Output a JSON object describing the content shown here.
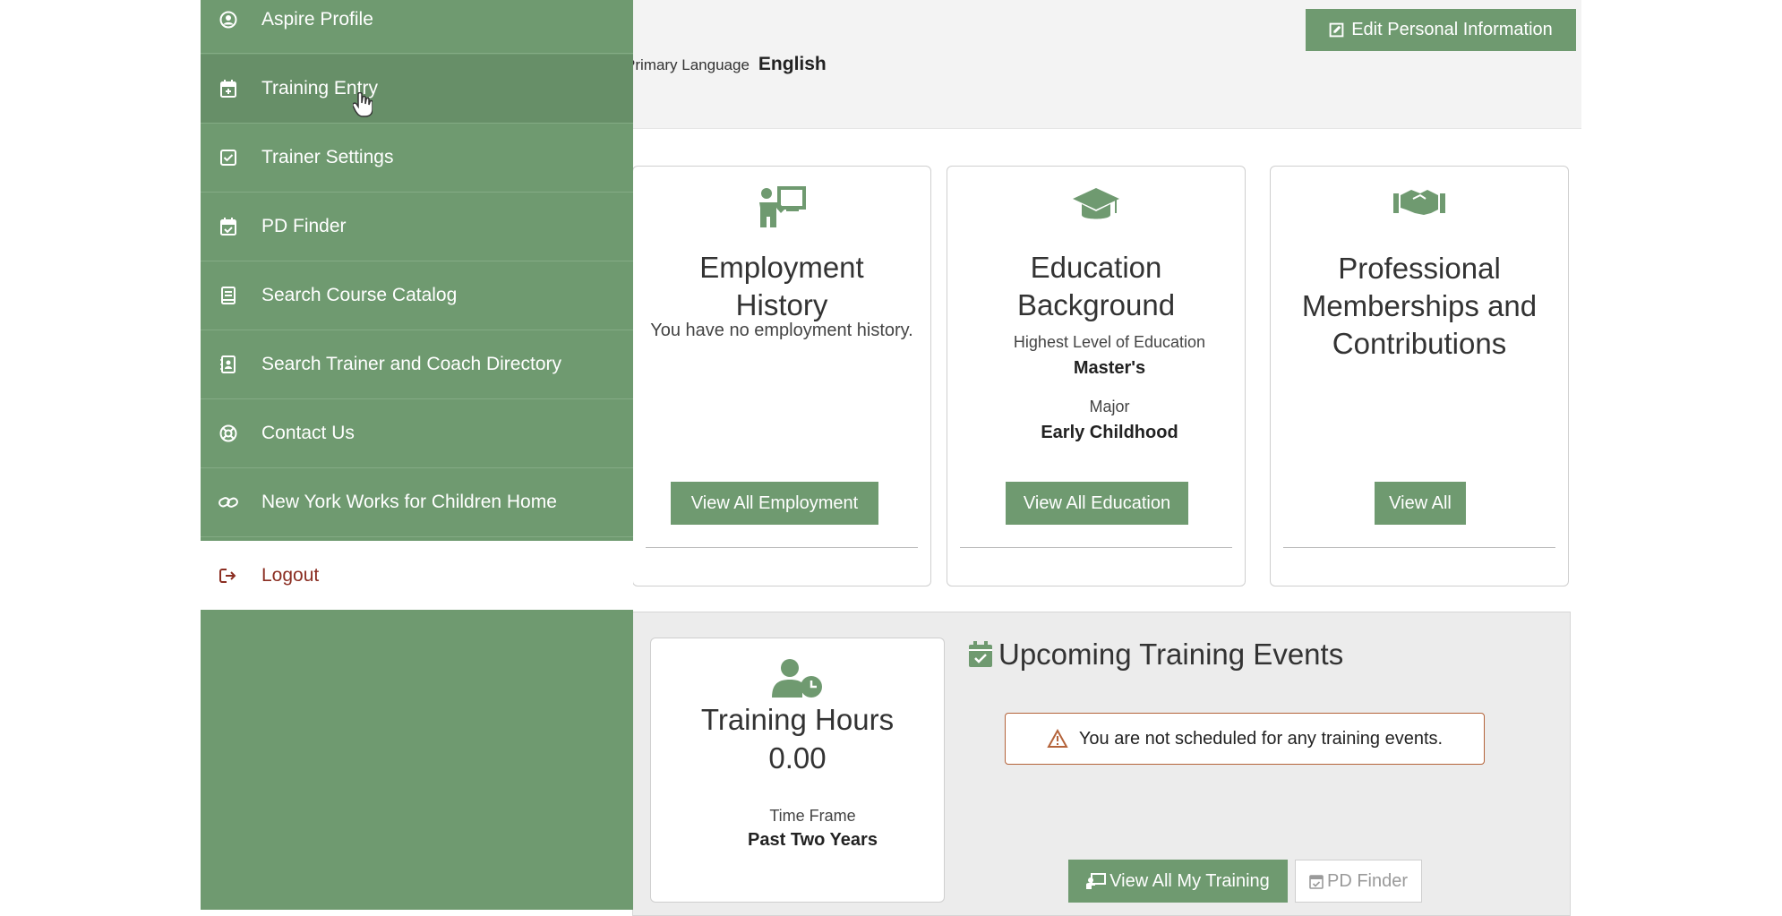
{
  "sidebar": {
    "items": [
      {
        "label": "Aspire Profile",
        "icon": "user-circle-icon"
      },
      {
        "label": "Training Entry",
        "icon": "calendar-plus-icon"
      },
      {
        "label": "Trainer Settings",
        "icon": "check-square-icon"
      },
      {
        "label": "PD Finder",
        "icon": "calendar-check-icon"
      },
      {
        "label": "Search Course Catalog",
        "icon": "book-icon"
      },
      {
        "label": "Search Trainer and Coach Directory",
        "icon": "address-book-icon"
      },
      {
        "label": "Contact Us",
        "icon": "life-ring-icon"
      },
      {
        "label": "New York Works for Children Home",
        "icon": "link-icon"
      },
      {
        "label": "Logout",
        "icon": "sign-out-icon"
      }
    ]
  },
  "header": {
    "edit_button": "Edit Personal Information",
    "primary_language_label": "Primary Language",
    "primary_language_value": "English"
  },
  "employment": {
    "title_line1": "Employment",
    "title_line2": "History",
    "empty_text": "You have no employment history.",
    "button": "View All Employment"
  },
  "education": {
    "title_line1": "Education",
    "title_line2": "Background",
    "level_label": "Highest Level of Education",
    "level_value": "Master's",
    "major_label": "Major",
    "major_value": "Early Childhood",
    "button": "View All Education"
  },
  "memberships": {
    "title_line1": "Professional",
    "title_line2": "Memberships and",
    "title_line3": "Contributions",
    "button": "View All"
  },
  "training_hours": {
    "title": "Training Hours",
    "value": "0.00",
    "timeframe_label": "Time Frame",
    "timeframe_value": "Past Two Years"
  },
  "upcoming": {
    "title": "Upcoming Training Events",
    "alert": "You are not scheduled for any training events.",
    "view_all_button": "View All My Training",
    "pd_finder_button": "PD Finder"
  },
  "colors": {
    "brand_green": "#6f9a70",
    "logout_red": "#8b2e22",
    "alert_border": "#b4633a"
  }
}
